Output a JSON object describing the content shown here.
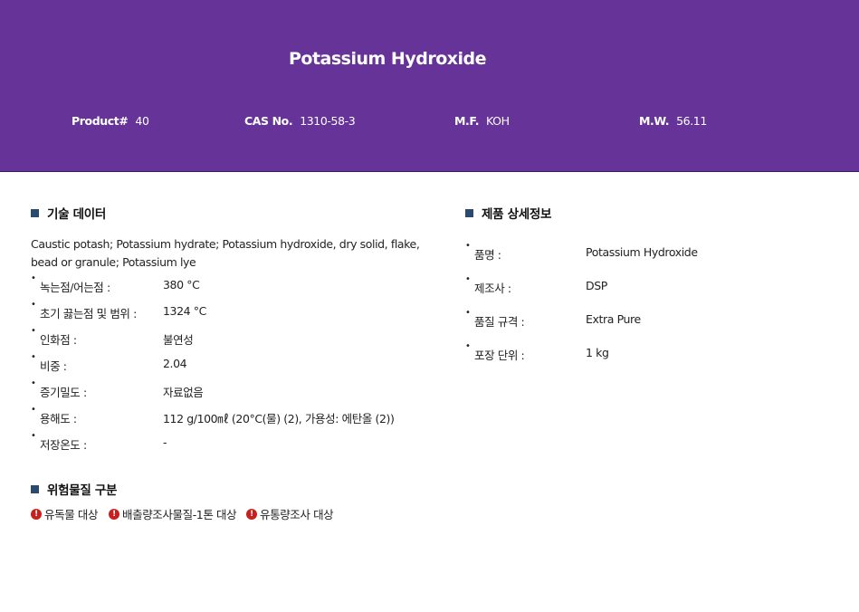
{
  "header": {
    "title": "Potassium Hydroxide",
    "product": {
      "label": "Product#",
      "value": "40"
    },
    "cas": {
      "label": "CAS No.",
      "value": "1310-58-3"
    },
    "mf": {
      "label": "M.F.",
      "value": "KOH"
    },
    "mw": {
      "label": "M.W.",
      "value": "56.11"
    }
  },
  "technical": {
    "heading": "기술 데이터",
    "description": "Caustic potash; Potassium hydrate; Potassium hydroxide, dry solid, flake, bead or granule; Potassium lye",
    "items": [
      {
        "label": "녹는점/어는점 :",
        "value": "380 °C"
      },
      {
        "label": "초기 끓는점 및 범위 :",
        "value": "1324 °C"
      },
      {
        "label": "인화점 :",
        "value": "불연성"
      },
      {
        "label": "비중 :",
        "value": "2.04"
      },
      {
        "label": "증기밀도 :",
        "value": "자료없음"
      },
      {
        "label": "용해도 :",
        "value": "112 g/100㎖ (20°C(물) (2), 가용성: 에탄올 (2))"
      },
      {
        "label": "저장온도 :",
        "value": "-"
      }
    ]
  },
  "details": {
    "heading": "제품 상세정보",
    "items": [
      {
        "label": "품명 :",
        "value": "Potassium Hydroxide"
      },
      {
        "label": "제조사 :",
        "value": "DSP"
      },
      {
        "label": "품질 규격 :",
        "value": "Extra Pure"
      },
      {
        "label": "포장 단위 :",
        "value": "1 kg"
      }
    ]
  },
  "hazard": {
    "heading": "위험물질 구분",
    "badges": [
      "유독물 대상",
      "배출량조사물질-1톤 대상",
      "유통량조사 대상"
    ],
    "icon": "exclamation-circle-icon",
    "icon_color": "#c8201e"
  },
  "colors": {
    "header_bg": "#663399",
    "heading_square": "#2b4a6f"
  }
}
